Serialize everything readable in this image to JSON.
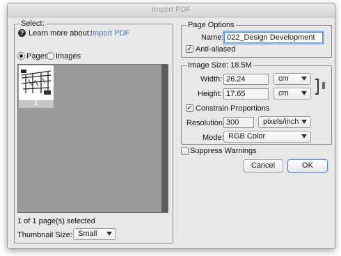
{
  "window": {
    "title": "Import PDF"
  },
  "select_panel": {
    "title": "Select:",
    "learn_more_prefix": "Learn more about:",
    "learn_more_link": "Import PDF",
    "radio_pages": "Pages",
    "radio_images": "Images",
    "radio_selected": "Pages",
    "thumbnail_page_number": "1",
    "selection_status": "1 of 1 page(s) selected",
    "thumbnail_size_label": "Thumbnail Size:",
    "thumbnail_size_value": "Small"
  },
  "page_options": {
    "title": "Page Options",
    "name_label": "Name:",
    "name_value": "022_Design Development",
    "anti_aliased_label": "Anti-aliased",
    "anti_aliased_checked": true
  },
  "image_size": {
    "title": "Image Size: 18.5M",
    "width_label": "Width:",
    "width_value": "26.24",
    "width_unit": "cm",
    "height_label": "Height:",
    "height_value": "17.65",
    "height_unit": "cm",
    "constrain_label": "Constrain Proportions",
    "constrain_checked": true,
    "resolution_label": "Resolution:",
    "resolution_value": "300",
    "resolution_unit": "pixels/inch",
    "mode_label": "Mode:",
    "mode_value": "RGB Color"
  },
  "suppress_warnings_label": "Suppress Warnings",
  "buttons": {
    "cancel": "Cancel",
    "ok": "OK"
  },
  "colors": {
    "link": "#3a7bd5",
    "focus_ring": "#8bb8f0",
    "preview_gray": "#9a9a9a"
  }
}
